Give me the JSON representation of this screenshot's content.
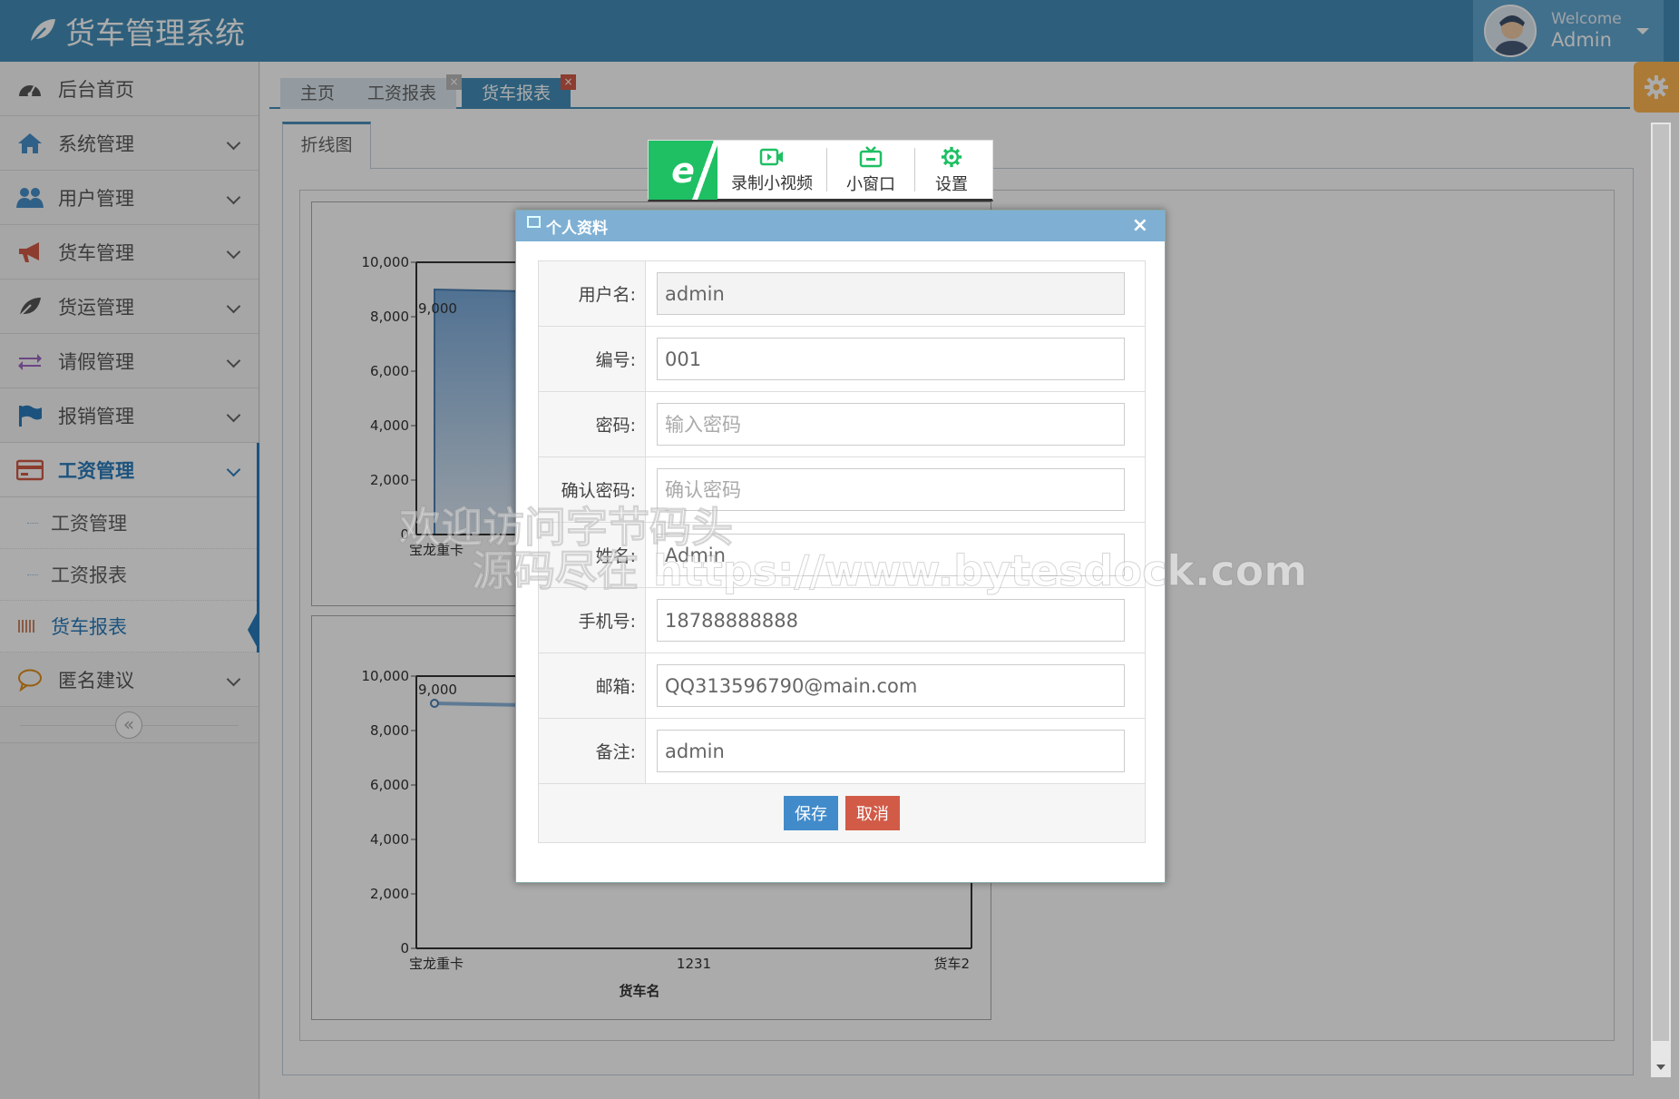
{
  "app": {
    "title": "货车管理系统"
  },
  "user": {
    "welcome": "Welcome",
    "name": "Admin"
  },
  "sidebar": {
    "items": [
      {
        "label": "后台首页"
      },
      {
        "label": "系统管理"
      },
      {
        "label": "用户管理"
      },
      {
        "label": "货车管理"
      },
      {
        "label": "货运管理"
      },
      {
        "label": "请假管理"
      },
      {
        "label": "报销管理"
      },
      {
        "label": "工资管理"
      },
      {
        "label": "匿名建议"
      }
    ],
    "sub_items": [
      {
        "label": "工资管理"
      },
      {
        "label": "工资报表"
      },
      {
        "label": "货车报表"
      }
    ],
    "collapse_glyph": "«"
  },
  "tabs": [
    {
      "label": "主页"
    },
    {
      "label": "工资报表"
    },
    {
      "label": "货车报表"
    }
  ],
  "tab_close_glyph": "×",
  "inner_tab": {
    "label": "折线图"
  },
  "float_toolbar": {
    "logo": "e",
    "record_label": "录制小视频",
    "mini_label": "小窗口",
    "settings_label": "设置"
  },
  "modal": {
    "title": "个人资料",
    "close_glyph": "×",
    "fields": [
      {
        "label": "用户名:",
        "value": "admin",
        "placeholder": ""
      },
      {
        "label": "编号:",
        "value": "001",
        "placeholder": ""
      },
      {
        "label": "密码:",
        "value": "",
        "placeholder": "输入密码"
      },
      {
        "label": "确认密码:",
        "value": "",
        "placeholder": "确认密码"
      },
      {
        "label": "姓名:",
        "value": "Admin",
        "placeholder": ""
      },
      {
        "label": "手机号:",
        "value": "18788888888",
        "placeholder": ""
      },
      {
        "label": "邮箱:",
        "value": "QQ313596790@main.com",
        "placeholder": ""
      },
      {
        "label": "备注:",
        "value": "admin",
        "placeholder": ""
      }
    ],
    "save_label": "保存",
    "cancel_label": "取消"
  },
  "watermark": {
    "line1": "欢迎访问字节码头",
    "line2": "源码尽在 https://www.bytesdock.com"
  },
  "chart_data": [
    {
      "type": "area",
      "title": "",
      "xlabel": "",
      "ylabel": "",
      "y_ticks": [
        "0",
        "2,000",
        "4,000",
        "6,000",
        "8,000",
        "10,000"
      ],
      "ylim": [
        0,
        10000
      ],
      "categories": [
        "宝龙重卡"
      ],
      "values": [
        9000
      ],
      "data_labels": [
        "9,000"
      ]
    },
    {
      "type": "line",
      "title": "",
      "xlabel": "货车名",
      "ylabel": "",
      "y_ticks": [
        "0",
        "2,000",
        "4,000",
        "6,000",
        "8,000",
        "10,000"
      ],
      "ylim": [
        0,
        10000
      ],
      "categories": [
        "宝龙重卡",
        "1231",
        "货车2"
      ],
      "values": [
        9000
      ],
      "data_labels": [
        "9,000"
      ]
    }
  ],
  "colors": {
    "navbar": "#438eb9",
    "accent": "#2b7dbc",
    "save": "#428bca",
    "cancel": "#d15b47",
    "float_green": "#1fbf63"
  }
}
